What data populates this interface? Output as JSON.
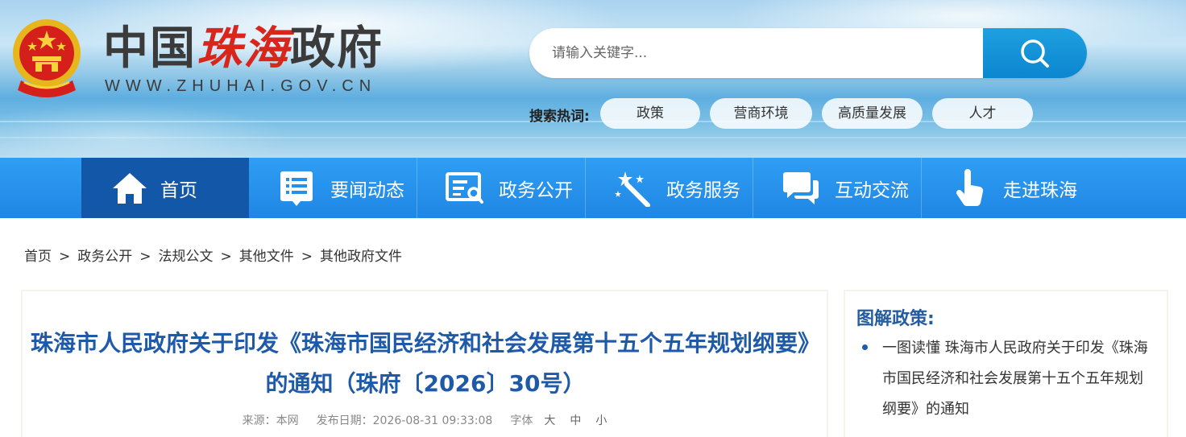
{
  "site": {
    "logo_dark": "中国",
    "logo_red": "珠海",
    "logo_tail": "政府",
    "logo_url": "WWW.ZHUHAI.GOV.CN"
  },
  "search": {
    "placeholder": "请输入关键字...",
    "hot_label": "搜索热词:",
    "hot_words": [
      "政策",
      "营商环境",
      "高质量发展",
      "人才"
    ]
  },
  "nav": {
    "items": [
      {
        "label": "首页",
        "icon": "home-icon"
      },
      {
        "label": "要闻动态",
        "icon": "news-list-icon"
      },
      {
        "label": "政务公开",
        "icon": "gov-open-icon"
      },
      {
        "label": "政务服务",
        "icon": "magic-wand-icon"
      },
      {
        "label": "互动交流",
        "icon": "chat-bubbles-icon"
      },
      {
        "label": "走进珠海",
        "icon": "pointer-hand-icon"
      }
    ]
  },
  "breadcrumb": [
    "首页",
    "政务公开",
    "法规公文",
    "其他文件",
    "其他政府文件"
  ],
  "article": {
    "title": "珠海市人民政府关于印发《珠海市国民经济和社会发展第十五个五年规划纲要》的通知（珠府〔2026〕30号）",
    "source_label": "来源：",
    "source": "本网",
    "date_label": "发布日期：",
    "date": "2026-08-31 09:33:08",
    "font_label": "字体",
    "font_sizes": [
      "大",
      "中",
      "小"
    ]
  },
  "sidebar": {
    "title": "图解政策:",
    "link": "一图读懂 珠海市人民政府关于印发《珠海市国民经济和社会发展第十五个五年规划纲要》的通知"
  },
  "colors": {
    "nav_bg": "#2f9ef3",
    "nav_active": "#1257a8",
    "title_blue": "#1e5aa8",
    "search_btn": "#0b86cf",
    "logo_red": "#d9261c"
  }
}
